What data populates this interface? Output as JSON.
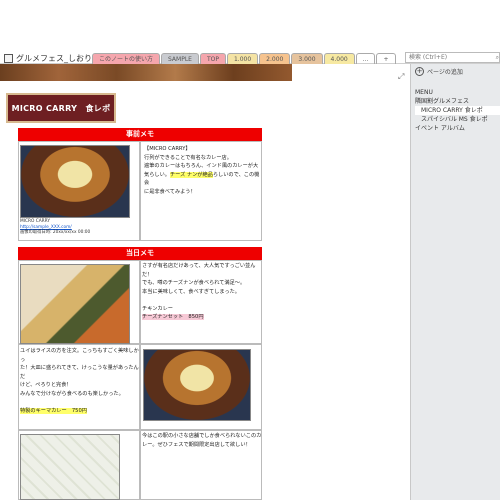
{
  "notebook": {
    "name": "グルメフェス_しおり"
  },
  "tabs": [
    {
      "label": "このノートの使い方",
      "color": "#f5a6ad"
    },
    {
      "label": "SAMPLE",
      "color": "#c9cbd0"
    },
    {
      "label": "TOP",
      "color": "#f5a6ad"
    },
    {
      "label": "1.000",
      "color": "#f4e3a4"
    },
    {
      "label": "2.000",
      "color": "#f6c38e"
    },
    {
      "label": "3.000",
      "color": "#e6c39d"
    },
    {
      "label": "4.000",
      "color": "#f7e9a2"
    },
    {
      "label": "...",
      "color": "#ffffff"
    },
    {
      "label": "+",
      "color": "#ffffff"
    }
  ],
  "search": {
    "placeholder": "検索 (Ctrl+E)"
  },
  "page": {
    "badge": "MICRO CARRY　食レポ",
    "sec1_title": "事前メモ",
    "sec1_text_a": "【MICRO CARRY】\n行列ができることで有名なカレー店。\n遍筆のカレーはもちろん、インド風のカレーが大\n気らしい。",
    "sec1_text_hl": "チーズ ナンが絶品",
    "sec1_text_b": "らしいので、この機会\nに是非食べてみよう！",
    "caption_name": "MICRO CARRY",
    "caption_link": "http://sample_XXX.com/",
    "caption_time": "画像の取得日時: 20xx/xx/xx 00:00",
    "sec2_title": "当日メモ",
    "sec2_text1": "さすが有名店だけあって、大人気ですっごい並んだ！\nでも、噂のチーズナンが食べられて満足〜。\n本当に美味しくて、食べすぎてしまった。\n\nチキンカレー",
    "sec2_hl1": "チーズナンセット　850円",
    "sec2_text2": "ユイはライスの方を注文。こっちもすごく美味しかっ\nた！大皿に盛られてきて、けっこうな量があったんだ\nけど、ぺろりと完食！\nみんなで分けながら食べるのも楽しかった。",
    "sec2_hl2": "特製のキーマカレー　750円",
    "sec2_text3": "今はこの駅の小さな店舗でしか食べられないこのカ\nレー。ぜひフェスで期間限定出店して欲しい！"
  },
  "panel": {
    "add_page": "ページの追加",
    "pages": [
      {
        "label": "MENU",
        "level": 0,
        "selected": false
      },
      {
        "label": "隣国割グルメフェス",
        "level": 0,
        "selected": false
      },
      {
        "label": "MICRO CARRY 食レポ",
        "level": 1,
        "selected": true
      },
      {
        "label": "スパイシバル MS 食レポ",
        "level": 1,
        "selected": false
      },
      {
        "label": "イベント アルバム",
        "level": 0,
        "selected": false
      }
    ]
  }
}
